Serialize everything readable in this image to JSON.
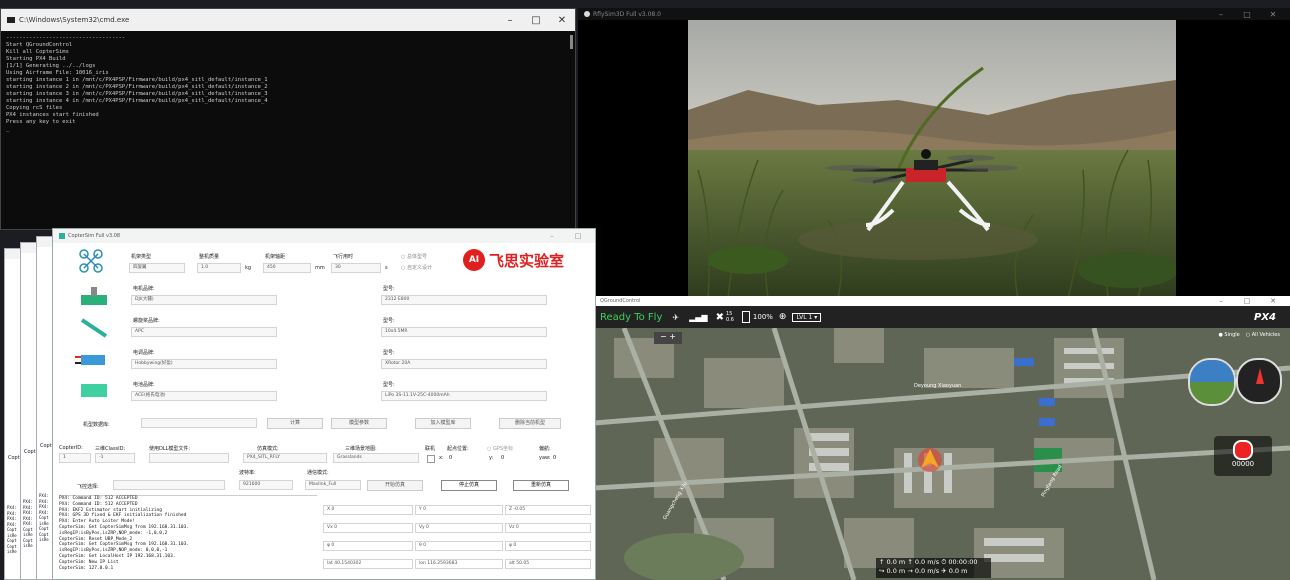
{
  "cmd": {
    "title": "C:\\Windows\\System32\\cmd.exe",
    "lines": "------------------------------------\nStart QGroundControl\nKill all CopterSims\nStarting PX4 Build\n[1/1] Generating ../../logs\nUsing Airframe File: 10016_iris\nstarting instance 1 in /mnt/c/PX4PSP/Firmware/build/px4_sitl_default/instance_1\nstarting instance 2 in /mnt/c/PX4PSP/Firmware/build/px4_sitl_default/instance_2\nstarting instance 3 in /mnt/c/PX4PSP/Firmware/build/px4_sitl_default/instance_3\nstarting instance 4 in /mnt/c/PX4PSP/Firmware/build/px4_sitl_default/instance_4\nCopying rcS files\nPX4 instances start finished\nPress any key to exit\n_"
  },
  "rflysim": {
    "title": "RflySim3D Full v3.08.0"
  },
  "qgc": {
    "title": "QGroundControl",
    "status": "Ready To Fly",
    "sats": "15",
    "hdop": "0.6",
    "battery": "100%",
    "vehicle": "LVL 1 ▾",
    "logo": "PX4",
    "view_single": "Single",
    "view_all": "All Vehicles",
    "rec": "00000",
    "telemetry_row1": "↑ 0.0 m   ↑ 0.0 m/s   ⏱ 00:00:00",
    "telemetry_row2": "↪ 0.0 m   → 0.0 m/s   ✈ 0.0 m",
    "map_labels": [
      "Deyoung Xiaoyuan",
      "Guangcheng Xilu",
      "Pingfang Road"
    ]
  },
  "csim": {
    "title": "CopterSim Full v3.08",
    "frame_type_label": "机架类型",
    "frame_type_value": "四旋翼",
    "mass_label": "整机质量",
    "mass_value": "1.0",
    "mass_unit": "kg",
    "wheelbase_label": "机架轴距",
    "wheelbase_value": "450",
    "wheelbase_unit": "mm",
    "flight_time_label": "飞行用时",
    "flight_time_value": "30",
    "flight_time_unit": "s",
    "radio_a": "总体型号",
    "radio_b": "自定义设计",
    "brand": "飞思实验室",
    "motor_label": "电机品牌:",
    "motor_value": "DJI(大疆)",
    "motor_model_label": "型号:",
    "motor_model_value": "2312 E800",
    "prop_label": "螺旋桨品牌:",
    "prop_value": "APC",
    "prop_model_label": "型号:",
    "prop_model_value": "10x4.5MR",
    "esc_label": "电调品牌:",
    "esc_value": "Hobbywing(好盈)",
    "esc_model_label": "型号:",
    "esc_model_value": "XRotor 20A",
    "batt_label": "电池品牌:",
    "batt_value": "ACE(格氏电池)",
    "batt_model_label": "型号:",
    "batt_model_value": "LiPo 3S-11.1V-25C-4000mAh",
    "db_label": "机型数据库:",
    "btn_calc": "计算",
    "btn_params": "模型参数",
    "btn_add": "加入模型库",
    "btn_delete": "删除当前机型",
    "copter_id_label": "CopterID:",
    "copter_id_value": "1",
    "class_id_label": "三维ClassID:",
    "class_id_value": "-1",
    "dll_label": "使用DLL模型文件:",
    "sim_mode_label": "仿真模式:",
    "sim_mode_value": "PX4_SITL_RFLY",
    "map_label": "三维场景地图:",
    "map_value": "Grasslands",
    "net_label": "联机",
    "pos_label": "起点位置:",
    "gps_label": "GPS坐标",
    "heading_label": "偏航:",
    "x_label": "x:",
    "x_value": "0",
    "y_label": "y:",
    "y_value": "0",
    "yaw_label": "yaw:",
    "yaw_value": "0",
    "baud_label": "波特率:",
    "baud_value": "921600",
    "comm_label": "通信模式:",
    "comm_value": "Mavlink_Full",
    "ctrl_label": "飞控选择:",
    "btn_start": "开始仿真",
    "btn_stop": "停止仿真",
    "btn_reset": "重新仿真",
    "log": "PX4: Command ID: 512 ACCEPTED\nPX4: Command ID: 512 ACCEPTED\nPX4: EKF2 Estimator start initializing\nPX4: GPS 3D fixed & EKF initialization finished\nPX4: Enter Auto Loiter Mode!\nCopterSim: Get CopterSimMsg from 192.168.31.103.\nisRegIP:isByPos,isZRP,NOP_mode: -1,0,0,2\nCopterSim: Reset UBP_Mode_2\nCopterSim: Get CopterSimMsg from 192.168.31.103.\nisRegIP:isByPos,isZRP,NOP_mode: 0,0,0,-1\nCopterSim: Get LocalHost IP 192.168.31.103.\nCopterSim: New IP List\nCopterSim: 127.0.0.1",
    "state_x": "X 0",
    "state_y": "Y 0",
    "state_z": "Z -0.05",
    "state_vx": "Vx 0",
    "state_vy": "Vy 0",
    "state_vz": "Vz 0",
    "state_phi": "φ 0",
    "state_theta": "θ 0",
    "state_psi": "ψ 0",
    "lat": "lat 40.1540302",
    "lon": "lon 116.2593683",
    "alt": "alt 50.05"
  },
  "bg": {
    "left_label_a": "Copt",
    "left_log": "PX4:\nPX4:\nPX4:\nPX4:\nCopt\nisRe\nCopt\nCopt\nisRe",
    "left_log2": "PX4:\nPX4:\nPX4:\nPX4:\nPX4:\nCopt\nisRe\nCopt\nisRe"
  },
  "colors": {
    "qgc_green": "#3dd15b",
    "brand_red": "#e02020"
  }
}
